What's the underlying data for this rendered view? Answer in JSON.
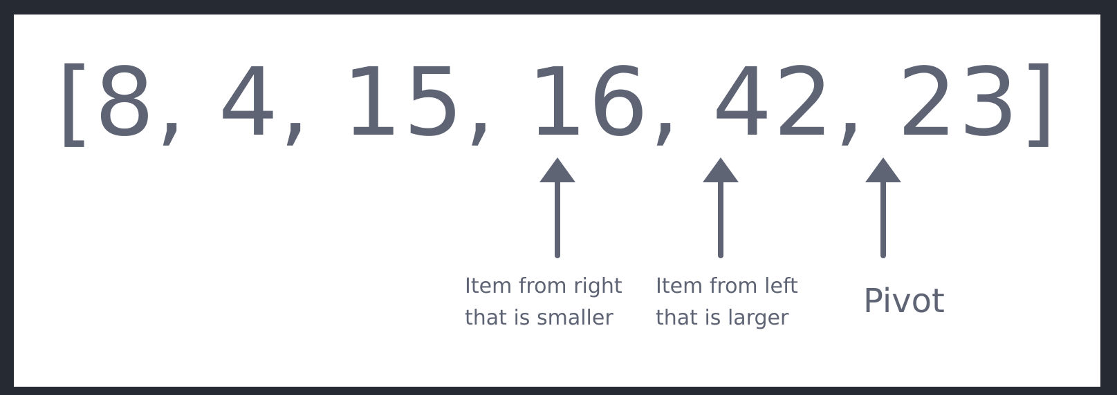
{
  "array": {
    "text": "[8, 4, 15, 16, 42, 23]"
  },
  "labels": {
    "smaller": {
      "line1": "Item from right",
      "line2": "that is smaller"
    },
    "larger": {
      "line1": "Item from left",
      "line2": "that is larger"
    },
    "pivot": "Pivot"
  },
  "colors": {
    "ink": "#5e6474",
    "background": "#ffffff",
    "frame": "#262a33"
  }
}
